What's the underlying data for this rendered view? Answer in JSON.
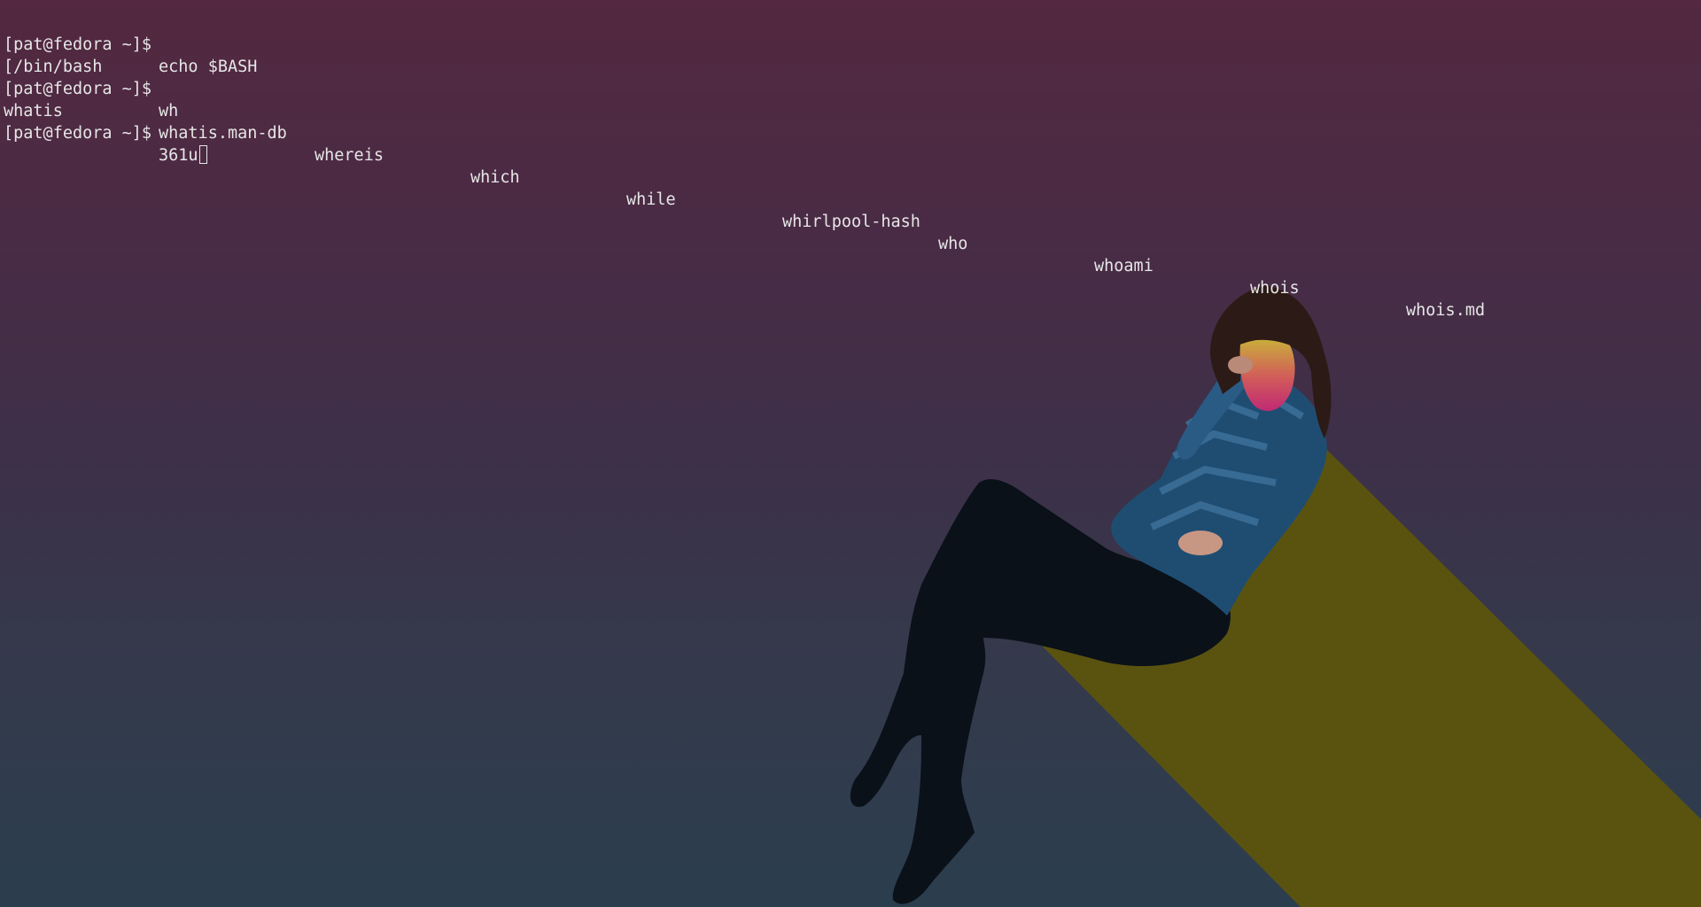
{
  "terminal": {
    "prompt": "[pat@fedora ~]$",
    "lines": [
      {
        "kind": "command",
        "text": "echo $BASH"
      },
      {
        "kind": "output",
        "text": "[/bin/bash"
      },
      {
        "kind": "command",
        "text": "wh"
      },
      {
        "kind": "completions",
        "items": [
          "whatis",
          "whatis.man-db",
          "whereis",
          "which",
          "while",
          "whirlpool-hash",
          "who",
          "whoami",
          "whois",
          "whois.md"
        ]
      },
      {
        "kind": "input",
        "text": "361u"
      }
    ]
  },
  "colors": {
    "text": "#e6e6e6",
    "bg_top": "#532840",
    "bg_bottom": "#2b3e4e",
    "shadow": "#5a5310"
  },
  "wallpaper": {
    "subject": "figure-sitting-with-shadow"
  }
}
